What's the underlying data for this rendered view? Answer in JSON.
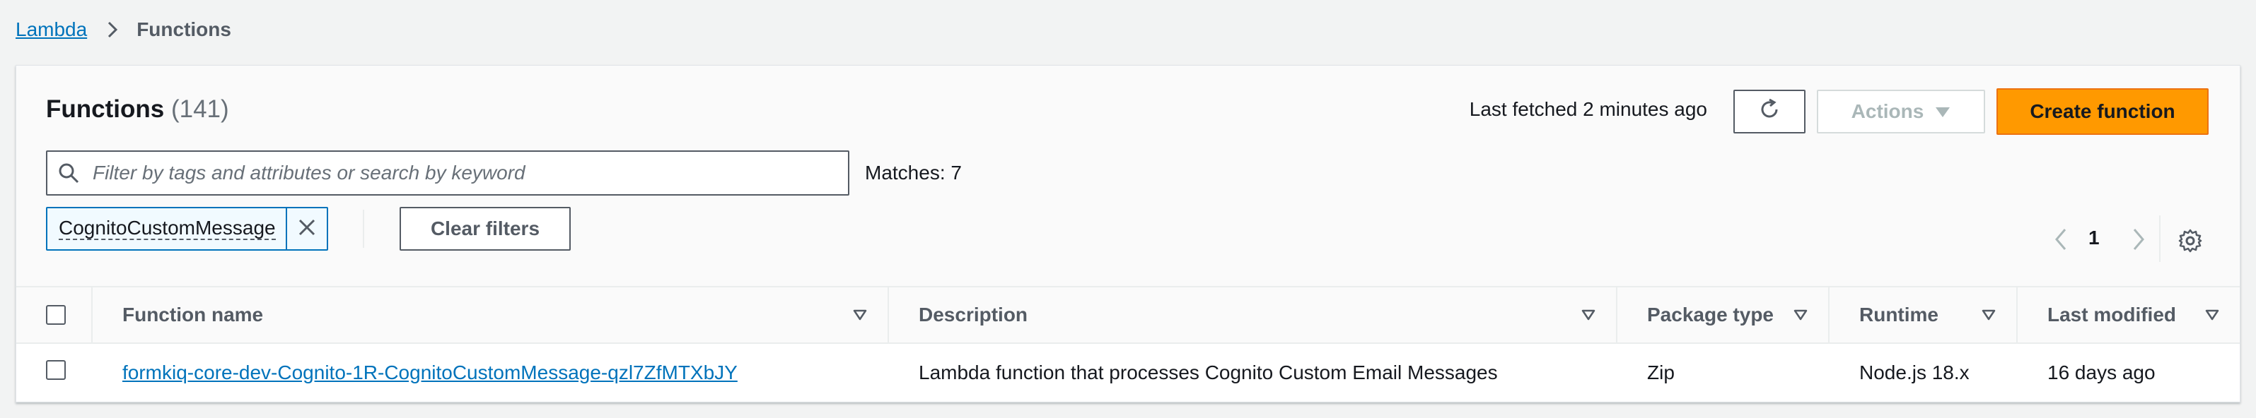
{
  "breadcrumb": {
    "root": "Lambda",
    "current": "Functions"
  },
  "header": {
    "title": "Functions",
    "count": "(141)",
    "last_fetched": "Last fetched 2 minutes ago",
    "actions_label": "Actions",
    "create_label": "Create function"
  },
  "filter": {
    "placeholder": "Filter by tags and attributes or search by keyword",
    "value": "",
    "matches": "Matches: 7",
    "token": "CognitoCustomMessage",
    "clear_label": "Clear filters"
  },
  "pagination": {
    "current_page": "1"
  },
  "table": {
    "columns": [
      "Function name",
      "Description",
      "Package type",
      "Runtime",
      "Last modified"
    ],
    "rows": [
      {
        "name": "formkiq-core-dev-Cognito-1R-CognitoCustomMessage-qzl7ZfMTXbJY",
        "description": "Lambda function that processes Cognito Custom Email Messages",
        "package_type": "Zip",
        "runtime": "Node.js 18.x",
        "last_modified": "16 days ago"
      }
    ]
  },
  "icons": {
    "breadcrumb_separator": "chevron-right-icon",
    "refresh": "refresh-icon",
    "actions_caret": "caret-down-icon",
    "search": "search-icon",
    "token_remove": "close-icon",
    "page_prev": "chevron-left-icon",
    "page_next": "chevron-right-icon",
    "settings": "gear-icon",
    "sort": "caret-down-icon"
  },
  "colors": {
    "link": "#0073bb",
    "primary_button": "#ff9900",
    "border_dark": "#545b64",
    "disabled": "#aab7b8"
  }
}
